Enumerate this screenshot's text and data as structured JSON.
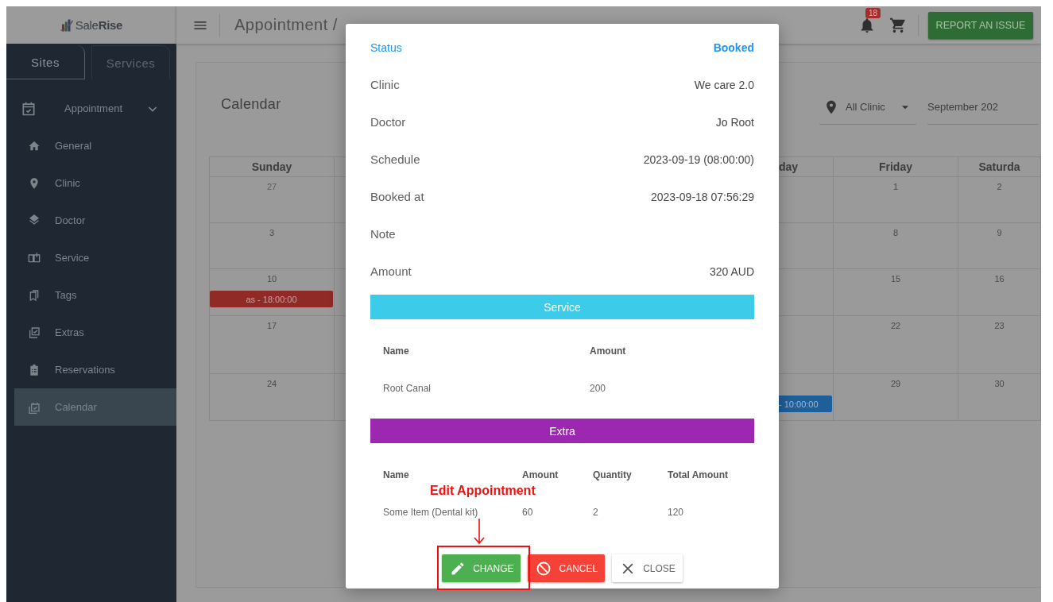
{
  "app": {
    "logo": "Sale**Rise**"
  },
  "sidebar": {
    "tabs": [
      {
        "label": "Sites",
        "selected": true
      },
      {
        "label": "Services",
        "selected": false
      }
    ],
    "nav": {
      "label": "Appointment",
      "expanded": true,
      "children": [
        {
          "label": "General",
          "selected": false
        },
        {
          "label": "Clinic",
          "selected": false
        },
        {
          "label": "Doctor",
          "selected": false
        },
        {
          "label": "Service",
          "selected": false
        },
        {
          "label": "Tags",
          "selected": false
        },
        {
          "label": "Extras",
          "selected": false
        },
        {
          "label": "Reservations",
          "selected": false
        },
        {
          "label": "Calendar",
          "selected": true
        }
      ]
    }
  },
  "topbar": {
    "breadcrumb": "Appointment /",
    "notifications": "18",
    "report_button": "REPORT AN ISSUE"
  },
  "page": {
    "title": "Calendar",
    "clinic_filter": "All Clinic",
    "month_filter": "September 202"
  },
  "calendar": {
    "columns": [
      {
        "kind": "full",
        "header": "Sunday",
        "cells": [
          {
            "day": "27",
            "outside": true
          },
          {
            "day": "3",
            "outside": false
          },
          {
            "day": "10",
            "outside": false,
            "event": {
              "label": "as - 18:00:00",
              "color": "#8f2a26"
            }
          },
          {
            "day": "17",
            "outside": false
          },
          {
            "day": "24",
            "outside": false
          }
        ]
      },
      {
        "kind": "covered"
      },
      {
        "kind": "covered"
      },
      {
        "kind": "covered"
      },
      {
        "kind": "cut_left",
        "header": "day",
        "cells": [
          {},
          {},
          {},
          {},
          {
            "event": {
              "label": "- 10:00:00",
              "color": "#1f5f99"
            }
          }
        ]
      },
      {
        "kind": "full",
        "header": "Friday",
        "cells": [
          {
            "day": "1",
            "outside": false
          },
          {
            "day": "8",
            "outside": false
          },
          {
            "day": "15",
            "outside": false
          },
          {
            "day": "22",
            "outside": false
          },
          {
            "day": "29",
            "outside": false
          }
        ]
      },
      {
        "kind": "full",
        "header": "Saturda",
        "cells": [
          {
            "day": "2",
            "outside": false
          },
          {
            "day": "9",
            "outside": false
          },
          {
            "day": "16",
            "outside": false
          },
          {
            "day": "23",
            "outside": false
          },
          {
            "day": "30",
            "outside": false
          }
        ]
      }
    ]
  },
  "modal": {
    "details": [
      {
        "label": "Status",
        "value": "Booked",
        "kind": "status"
      },
      {
        "label": "Clinic",
        "value": "We care 2.0",
        "kind": "plain"
      },
      {
        "label": "Doctor",
        "value": "Jo Root",
        "kind": "plain"
      },
      {
        "label": "Schedule",
        "value": "2023-09-19 (08:00:00)",
        "kind": "plain"
      },
      {
        "label": "Booked at",
        "value": "2023-09-18 07:56:29",
        "kind": "plain"
      },
      {
        "label": "Note",
        "kind": "plain"
      },
      {
        "label": "Amount",
        "value": "320 AUD",
        "kind": "plain"
      }
    ],
    "sections": [
      {
        "title": "Service",
        "color": "#3ccbe8",
        "columns": [
          "Name",
          "Amount"
        ],
        "rows": [
          [
            "Root Canal",
            "200"
          ]
        ]
      },
      {
        "title": "Extra",
        "color": "#9c27b0",
        "columns": [
          "Name",
          "Amount",
          "Quantity",
          "Total Amount"
        ],
        "rows": [
          [
            "Some Item (Dental kit)",
            "60",
            "2",
            "120"
          ]
        ]
      }
    ],
    "buttons": [
      {
        "label": "CHANGE",
        "kind": "change"
      },
      {
        "label": "CANCEL",
        "kind": "cancel"
      },
      {
        "label": "CLOSE",
        "kind": "close"
      }
    ]
  },
  "annotation": {
    "label": "Edit Appointment"
  }
}
